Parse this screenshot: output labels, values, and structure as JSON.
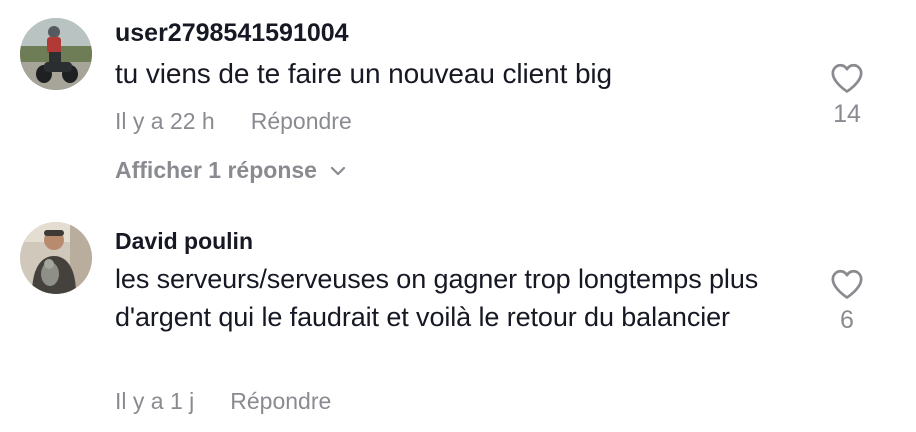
{
  "comments": [
    {
      "username": "user2798541591004",
      "text": "tu viens de te faire un nouveau client big",
      "time": "Il y a 22 h",
      "reply_label": "Répondre",
      "likes": "14",
      "avatar_icon": "motorcycle-rider-avatar",
      "view_replies_label": "Afficher 1 réponse"
    },
    {
      "username": "David poulin",
      "text": "les serveurs/serveuses on gagner trop longtemps plus d'argent qui le faudrait et voilà le retour du balancier",
      "time": "Il y a 1 j",
      "reply_label": "Répondre",
      "likes": "6",
      "avatar_icon": "person-with-pet-avatar"
    }
  ],
  "colors": {
    "primary_text": "#161823",
    "secondary_text": "#8a8b91"
  }
}
